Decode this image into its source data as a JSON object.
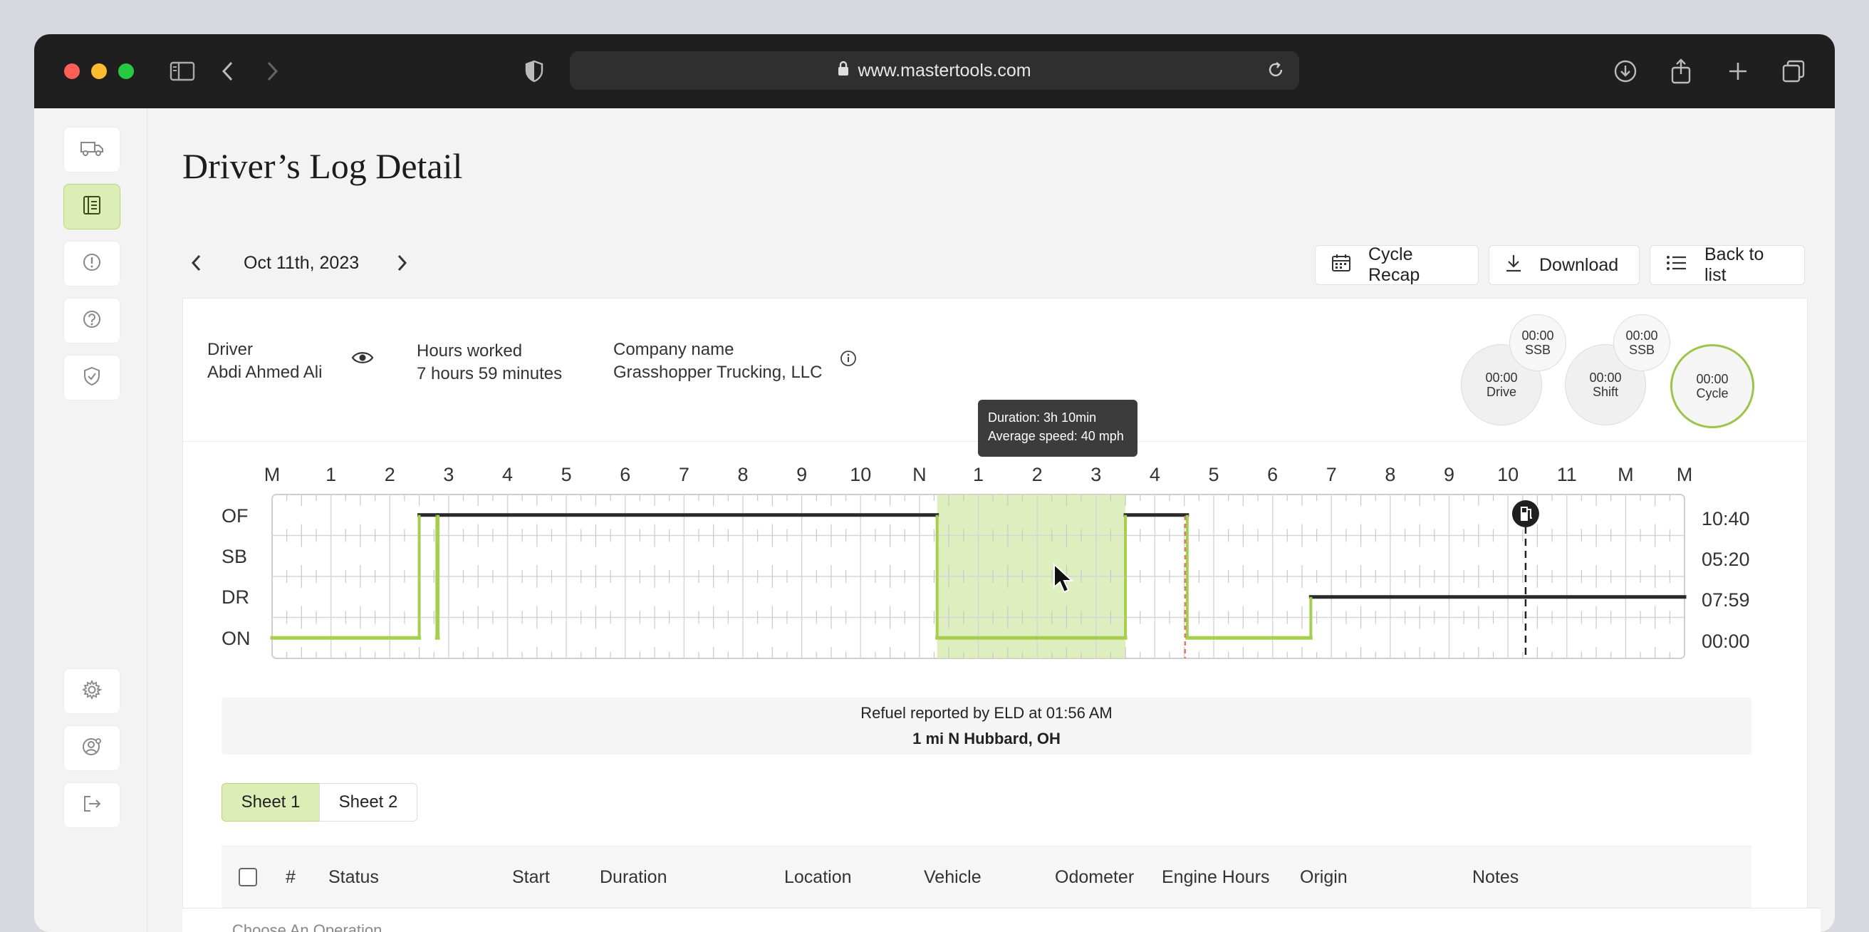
{
  "browser": {
    "url": "www.mastertools.com",
    "icons": [
      "sidebar-toggle-icon",
      "back-icon",
      "forward-icon",
      "shield-icon",
      "lock-icon",
      "reload-icon",
      "download-icon",
      "share-icon",
      "new-tab-icon",
      "tabs-icon"
    ]
  },
  "sidebar": {
    "items": [
      {
        "name": "truck-icon",
        "active": false
      },
      {
        "name": "logbook-icon",
        "active": true
      },
      {
        "name": "alert-icon",
        "active": false
      },
      {
        "name": "help-icon",
        "active": false
      },
      {
        "name": "shield-check-icon",
        "active": false
      },
      {
        "name": "settings-icon",
        "active": false
      },
      {
        "name": "user-settings-icon",
        "active": false
      },
      {
        "name": "logout-icon",
        "active": false
      }
    ]
  },
  "page": {
    "title": "Driver’s Log Detail",
    "date": "Oct 11th, 2023"
  },
  "actions": {
    "cycle_recap": "Cycle Recap",
    "download": "Download",
    "back_to_list": "Back to list"
  },
  "driver": {
    "driver_label": "Driver",
    "driver_name": "Abdi Ahmed Ali",
    "hours_label": "Hours worked",
    "hours_value": "7 hours 59 minutes",
    "company_label": "Company name",
    "company_value": "Grasshopper Trucking, LLC"
  },
  "timers": {
    "drive": {
      "time": "00:00",
      "label": "Drive"
    },
    "ssb1": {
      "time": "00:00",
      "label": "SSB"
    },
    "shift": {
      "time": "00:00",
      "label": "Shift"
    },
    "ssb2": {
      "time": "00:00",
      "label": "SSB"
    },
    "cycle": {
      "time": "00:00",
      "label": "Cycle"
    }
  },
  "tooltip": {
    "line1": "Duration: 3h 10min",
    "line2": "Average speed: 40 mph"
  },
  "chart_data": {
    "type": "line",
    "x_ticks": [
      "M",
      "1",
      "2",
      "3",
      "4",
      "5",
      "6",
      "7",
      "8",
      "9",
      "10",
      "N",
      "1",
      "2",
      "3",
      "4",
      "5",
      "6",
      "7",
      "8",
      "9",
      "10",
      "11",
      "M"
    ],
    "rows": [
      "OF",
      "SB",
      "DR",
      "ON"
    ],
    "row_totals": [
      "10:40",
      "05:20",
      "07:59",
      "00:00"
    ],
    "status_segments": [
      {
        "status": "ON",
        "from": 0.0,
        "to": 2.5
      },
      {
        "status": "OF",
        "from": 2.5,
        "to": 2.8
      },
      {
        "status": "ON",
        "from": 2.8,
        "to": 2.82
      },
      {
        "status": "OF",
        "from": 2.82,
        "to": 11.3
      },
      {
        "status": "ON",
        "from": 11.3,
        "to": 14.5
      },
      {
        "status": "OF",
        "from": 14.5,
        "to": 15.55
      },
      {
        "status": "ON",
        "from": 15.55,
        "to": 17.65
      },
      {
        "status": "DR",
        "from": 17.65,
        "to": 24.0
      }
    ],
    "highlight": {
      "from": 11.3,
      "to": 14.5
    },
    "refuel_at": 21.3,
    "current_marker": 15.55
  },
  "refuel": {
    "line1": "Refuel reported by ELD at 01:56 AM",
    "line2": "1 mi N Hubbard, OH"
  },
  "sheets": [
    "Sheet 1",
    "Sheet 2"
  ],
  "table": {
    "headers": [
      "#",
      "Status",
      "Start",
      "Duration",
      "Location",
      "Vehicle",
      "Odometer",
      "Engine Hours",
      "Origin",
      "Notes"
    ]
  },
  "next_row": {
    "placeholder": "Choose An Operation"
  }
}
